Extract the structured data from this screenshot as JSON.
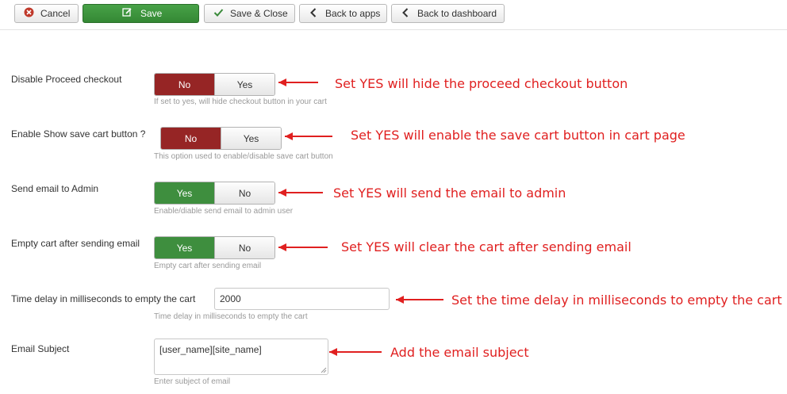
{
  "toolbar": {
    "cancel_label": "Cancel",
    "save_label": "Save",
    "save_close_label": "Save & Close",
    "back_apps_label": "Back to apps",
    "back_dashboard_label": "Back to dashboard"
  },
  "colors": {
    "active_red": "#962525",
    "active_green": "#3e8e3e",
    "annotation": "#e02020"
  },
  "fields": {
    "disable_proceed": {
      "label": "Disable Proceed checkout",
      "options": [
        "No",
        "Yes"
      ],
      "selected": "No",
      "hint": "If set to yes, will hide checkout button in your cart",
      "annotation": "Set YES will hide the proceed checkout button"
    },
    "show_save_cart": {
      "label": "Enable Show save cart button ?",
      "options": [
        "No",
        "Yes"
      ],
      "selected": "No",
      "hint": "This option used to enable/disable save cart button",
      "annotation": "Set YES will enable the save cart button in cart page"
    },
    "send_email_admin": {
      "label": "Send email to Admin",
      "options": [
        "Yes",
        "No"
      ],
      "selected": "Yes",
      "hint": "Enable/diable send email to admin user",
      "annotation": "Set YES will send the email to admin"
    },
    "empty_cart": {
      "label": "Empty cart after sending email",
      "options": [
        "Yes",
        "No"
      ],
      "selected": "Yes",
      "hint": "Empty cart after sending email",
      "annotation": "Set YES will clear the cart after sending email"
    },
    "time_delay": {
      "label": "Time delay in milliseconds to empty the cart",
      "value": "2000",
      "hint": "Time delay in milliseconds to empty the cart",
      "annotation": "Set the time delay in milliseconds to empty the cart"
    },
    "email_subject": {
      "label": "Email Subject",
      "value": "[user_name][site_name]",
      "hint": "Enter subject of email",
      "annotation": "Add the email subject"
    }
  }
}
